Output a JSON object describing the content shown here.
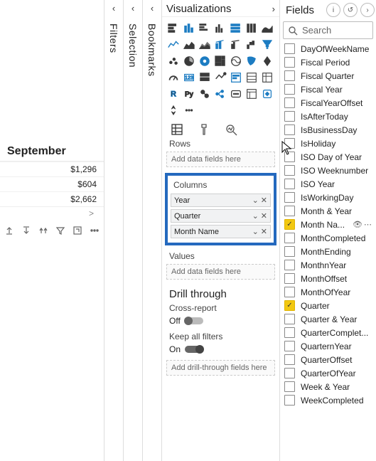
{
  "canvas": {
    "header": "September",
    "rows": [
      "$1,296",
      "$604",
      "$2,662"
    ],
    "scroll_indicator": ">"
  },
  "rails": {
    "filters": "Filters",
    "selection": "Selection",
    "bookmarks": "Bookmarks"
  },
  "viz_pane": {
    "title": "Visualizations",
    "rows_section": "Rows",
    "rows_placeholder": "Add data fields here",
    "columns_section": "Columns",
    "column_fields": [
      "Year",
      "Quarter",
      "Month Name"
    ],
    "values_section": "Values",
    "values_placeholder": "Add data fields here",
    "drill_title": "Drill through",
    "cross_report_label": "Cross-report",
    "cross_report_state": "Off",
    "keep_filters_label": "Keep all filters",
    "keep_filters_state": "On",
    "drill_placeholder": "Add drill-through fields here"
  },
  "viz_icons": [
    "stacked-bar",
    "stacked-column",
    "clustered-bar",
    "clustered-column",
    "100-stacked-bar",
    "100-stacked-column",
    "ribbon",
    "line",
    "area",
    "stacked-area",
    "line-stacked-column",
    "line-clustered-column",
    "waterfall",
    "funnel",
    "scatter",
    "pie",
    "donut",
    "treemap",
    "map",
    "filled-map",
    "azure-map",
    "gauge",
    "card",
    "multi-row-card",
    "kpi",
    "slicer",
    "table",
    "matrix",
    "r-visual",
    "py-visual",
    "key-influencers",
    "decomposition-tree",
    "qna",
    "paginated",
    "power-apps",
    "power-automate",
    "more-visuals"
  ],
  "fields_pane": {
    "title": "Fields",
    "search_placeholder": "Search",
    "fields": [
      {
        "label": "DayOfWeekName",
        "checked": false,
        "truncated": true
      },
      {
        "label": "Fiscal Period",
        "checked": false
      },
      {
        "label": "Fiscal Quarter",
        "checked": false
      },
      {
        "label": "Fiscal Year",
        "checked": false
      },
      {
        "label": "FiscalYearOffset",
        "checked": false
      },
      {
        "label": "IsAfterToday",
        "checked": false
      },
      {
        "label": "IsBusinessDay",
        "checked": false
      },
      {
        "label": "IsHoliday",
        "checked": false
      },
      {
        "label": "ISO Day of Year",
        "checked": false
      },
      {
        "label": "ISO Weeknumber",
        "checked": false
      },
      {
        "label": "ISO Year",
        "checked": false
      },
      {
        "label": "IsWorkingDay",
        "checked": false
      },
      {
        "label": "Month & Year",
        "checked": false
      },
      {
        "label": "Month Na...",
        "checked": true,
        "extras": true
      },
      {
        "label": "MonthCompleted",
        "checked": false
      },
      {
        "label": "MonthEnding",
        "checked": false
      },
      {
        "label": "MonthnYear",
        "checked": false
      },
      {
        "label": "MonthOffset",
        "checked": false
      },
      {
        "label": "MonthOfYear",
        "checked": false
      },
      {
        "label": "Quarter",
        "checked": true
      },
      {
        "label": "Quarter & Year",
        "checked": false
      },
      {
        "label": "QuarterComplet...",
        "checked": false
      },
      {
        "label": "QuarternYear",
        "checked": false
      },
      {
        "label": "QuarterOffset",
        "checked": false
      },
      {
        "label": "QuarterOfYear",
        "checked": false
      },
      {
        "label": "Week & Year",
        "checked": false
      },
      {
        "label": "WeekCompleted",
        "checked": false
      }
    ]
  }
}
